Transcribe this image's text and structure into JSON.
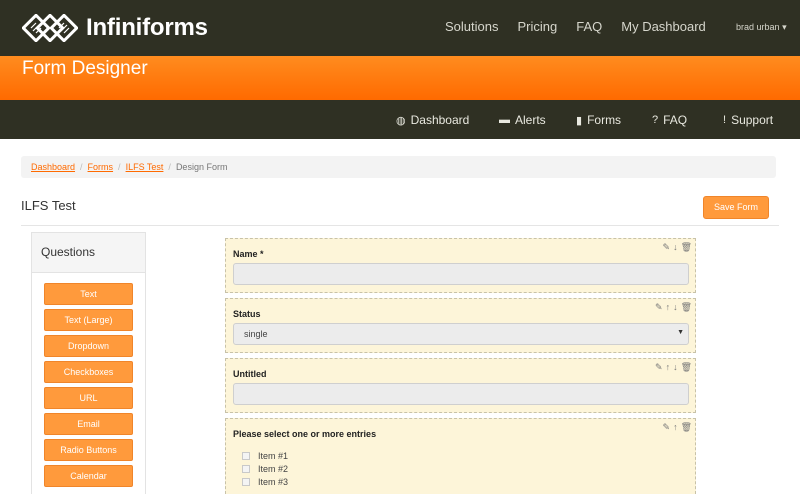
{
  "app": {
    "logo_text": "Infiniforms"
  },
  "topnav": {
    "links": [
      "Solutions",
      "Pricing",
      "FAQ",
      "My Dashboard"
    ],
    "user": "brad urban"
  },
  "banner": {
    "title": "Form Designer"
  },
  "subnav": {
    "items": [
      {
        "label": "Dashboard",
        "icon": "globe-icon"
      },
      {
        "label": "Alerts",
        "icon": "chat-icon"
      },
      {
        "label": "Forms",
        "icon": "document-icon"
      },
      {
        "label": "FAQ",
        "icon": "question-icon"
      },
      {
        "label": "Support",
        "icon": "exclamation-icon"
      }
    ]
  },
  "breadcrumb": {
    "items": [
      "Dashboard",
      "Forms",
      "ILFS Test"
    ],
    "current": "Design Form"
  },
  "page": {
    "title": "ILFS Test",
    "save_label": "Save Form"
  },
  "questions": {
    "title": "Questions",
    "buttons": [
      "Text",
      "Text (Large)",
      "Dropdown",
      "Checkboxes",
      "URL",
      "Email",
      "Radio Buttons",
      "Calendar"
    ]
  },
  "form": {
    "fields": [
      {
        "label": "Name *",
        "type": "text"
      },
      {
        "label": "Status",
        "type": "dropdown",
        "value": "single"
      },
      {
        "label": "Untitled",
        "type": "text"
      },
      {
        "label": "Please select one or more entries",
        "type": "checkboxes",
        "options": [
          "Item #1",
          "Item #2",
          "Item #3"
        ]
      }
    ]
  },
  "colors": {
    "dark": "#2f3023",
    "orange": "#ff6a00",
    "button": "#ff9a3c",
    "field_bg": "#fdf5d9"
  }
}
